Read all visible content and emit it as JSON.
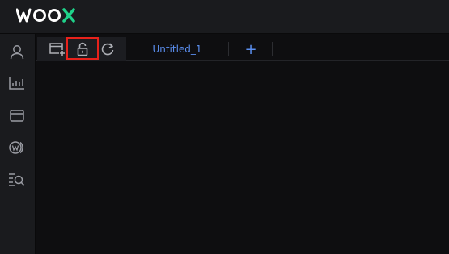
{
  "header": {
    "logo_text": "WOOX"
  },
  "sidebar": {
    "items": [
      {
        "icon": "user-icon"
      },
      {
        "icon": "chart-bars-icon"
      },
      {
        "icon": "wallet-icon"
      },
      {
        "icon": "woo-coin-icon"
      },
      {
        "icon": "search-list-icon"
      }
    ]
  },
  "toolbar": {
    "icons": [
      "new-window-icon",
      "unlock-icon",
      "refresh-icon"
    ],
    "tab_label": "Untitled_1",
    "add_tab_label": "+"
  },
  "colors": {
    "accent": "#5b8ff0",
    "logo_green": "#1fd28a",
    "highlight": "#e8221b"
  }
}
